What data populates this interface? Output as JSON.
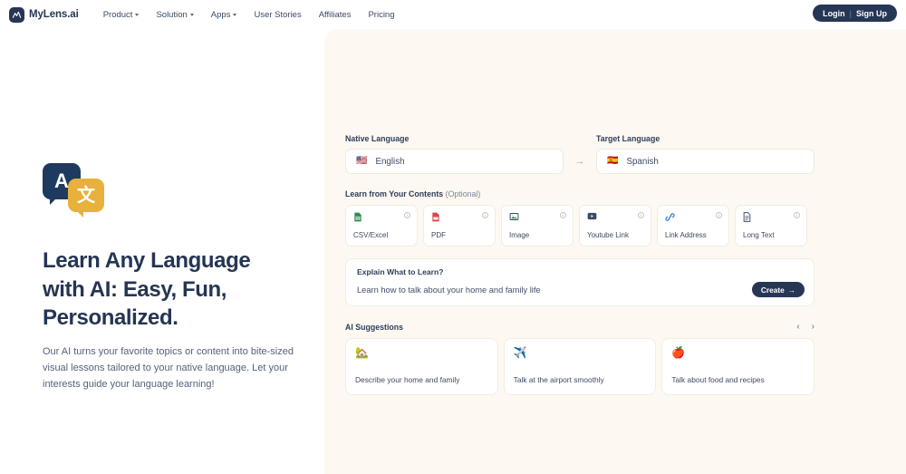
{
  "navbar": {
    "logo_icon": "mylens-logo-icon",
    "brand": "MyLens.ai",
    "links": [
      {
        "label": "Product",
        "has_dropdown": true
      },
      {
        "label": "Solution",
        "has_dropdown": true
      },
      {
        "label": "Apps",
        "has_dropdown": true
      },
      {
        "label": "User Stories",
        "has_dropdown": false
      },
      {
        "label": "Affiliates",
        "has_dropdown": false
      },
      {
        "label": "Pricing",
        "has_dropdown": false
      }
    ],
    "auth": {
      "login": "Login",
      "separator": "|",
      "signup": "Sign Up"
    }
  },
  "hero": {
    "logo": {
      "primary_glyph": "A",
      "secondary_glyph": "文"
    },
    "title": "Learn Any Language with AI: Easy, Fun, Personalized.",
    "subtitle": "Our AI turns your favorite topics or content into bite-sized visual lessons tailored to your native language. Let your interests guide your language learning!"
  },
  "form": {
    "native_label": "Native Language",
    "native_value": "English",
    "native_flag": "🇺🇸",
    "direction_arrow": "→",
    "target_label": "Target Language",
    "target_value": "Spanish",
    "target_flag": "🇪🇸",
    "contents_label": "Learn from Your Contents",
    "contents_optional": "(Optional)",
    "sources": [
      {
        "label": "CSV/Excel",
        "icon": "🗂",
        "icon_name": "csv-excel-file-icon",
        "info": "i"
      },
      {
        "label": "PDF",
        "icon": "📕",
        "icon_name": "pdf-file-icon",
        "info": "i"
      },
      {
        "label": "Image",
        "icon": "🖼",
        "icon_name": "image-file-icon",
        "info": "i"
      },
      {
        "label": "Youtube Link",
        "icon": "▶",
        "icon_name": "youtube-link-icon",
        "info": "i"
      },
      {
        "label": "Link Address",
        "icon": "🔗",
        "icon_name": "link-address-icon",
        "info": "i"
      },
      {
        "label": "Long Text",
        "icon": "📄",
        "icon_name": "long-text-icon",
        "info": "i"
      }
    ],
    "explain_label": "Explain What to Learn?",
    "explain_value": "Learn how to talk about your home and family life",
    "explain_placeholder": "Explain What to Learn?",
    "create_label": "Create",
    "create_arrow": "→"
  },
  "suggestions": {
    "title": "AI Suggestions",
    "prev_icon": "‹",
    "next_icon": "›",
    "items": [
      {
        "emoji": "🏡",
        "icon_name": "house-with-garden-emoji",
        "text": "Describe your home and family"
      },
      {
        "emoji": "✈️",
        "icon_name": "airplane-emoji",
        "text": "Talk at the airport smoothly"
      },
      {
        "emoji": "🍎",
        "icon_name": "apple-emoji",
        "text": "Talk about food and recipes"
      }
    ]
  },
  "colors": {
    "navy": "#263655",
    "cream_panel": "#fdf9f2",
    "gold": "#e8b13c",
    "card_white": "#ffffff"
  }
}
